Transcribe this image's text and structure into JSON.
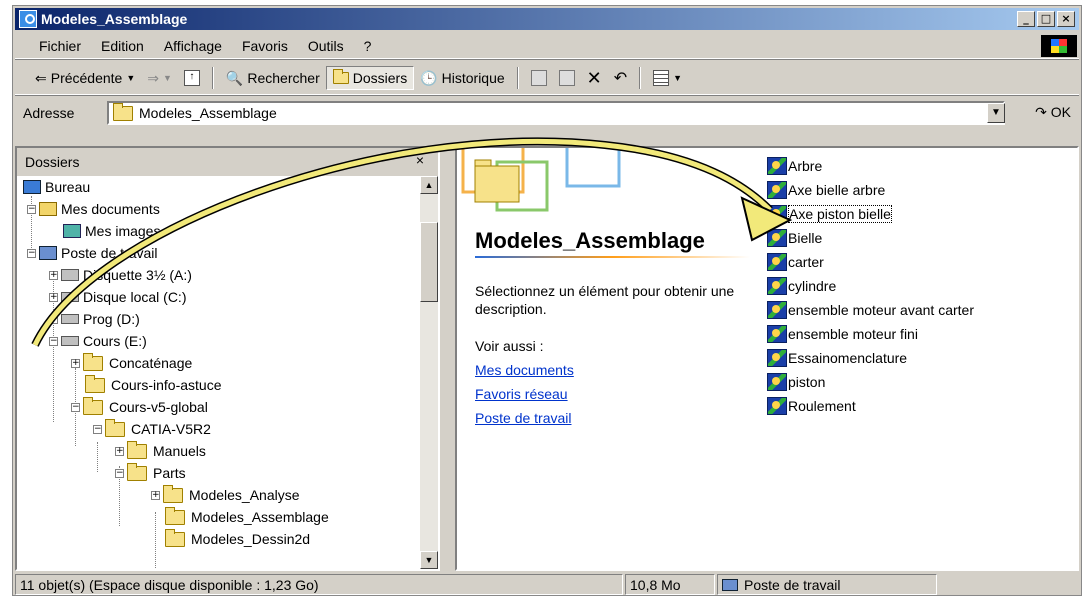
{
  "window": {
    "title": "Modeles_Assemblage",
    "min": "_",
    "max": "□",
    "close": "×"
  },
  "menu": [
    "Fichier",
    "Edition",
    "Affichage",
    "Favoris",
    "Outils",
    "?"
  ],
  "toolbar": {
    "back": "Précédente",
    "search": "Rechercher",
    "folders": "Dossiers",
    "history": "Historique"
  },
  "address": {
    "label": "Adresse",
    "value": "Modeles_Assemblage",
    "go": "OK"
  },
  "leftpane": {
    "title": "Dossiers",
    "close": "×",
    "tree": [
      {
        "label": "Bureau"
      },
      {
        "label": "Mes documents"
      },
      {
        "label": "Mes images"
      },
      {
        "label": "Poste de travail"
      },
      {
        "label": "Disquette 3½ (A:)"
      },
      {
        "label": "Disque local (C:)"
      },
      {
        "label": "Prog (D:)"
      },
      {
        "label": "Cours (E:)"
      },
      {
        "label": "Concaténage"
      },
      {
        "label": "Cours-info-astuce"
      },
      {
        "label": "Cours-v5-global"
      },
      {
        "label": "CATIA-V5R2"
      },
      {
        "label": "Manuels"
      },
      {
        "label": "Parts"
      },
      {
        "label": "Modeles_Analyse"
      },
      {
        "label": "Modeles_Assemblage"
      },
      {
        "label": "Modeles_Dessin2d"
      }
    ]
  },
  "rightpane": {
    "title": "Modeles_Assemblage",
    "description": "Sélectionnez un élément pour obtenir une description.",
    "see_also": "Voir aussi :",
    "links": [
      "Mes documents",
      "Favoris réseau",
      "Poste de travail"
    ],
    "files": [
      "Arbre",
      "Axe bielle arbre",
      "Axe piston bielle",
      "Bielle",
      "carter",
      "cylindre",
      "ensemble moteur avant carter",
      "ensemble moteur fini",
      "Essainomenclature",
      "piston",
      "Roulement"
    ]
  },
  "status": {
    "objects": "11 objet(s) (Espace disque disponible : 1,23 Go)",
    "size": "10,8 Mo",
    "zone": "Poste de travail"
  }
}
